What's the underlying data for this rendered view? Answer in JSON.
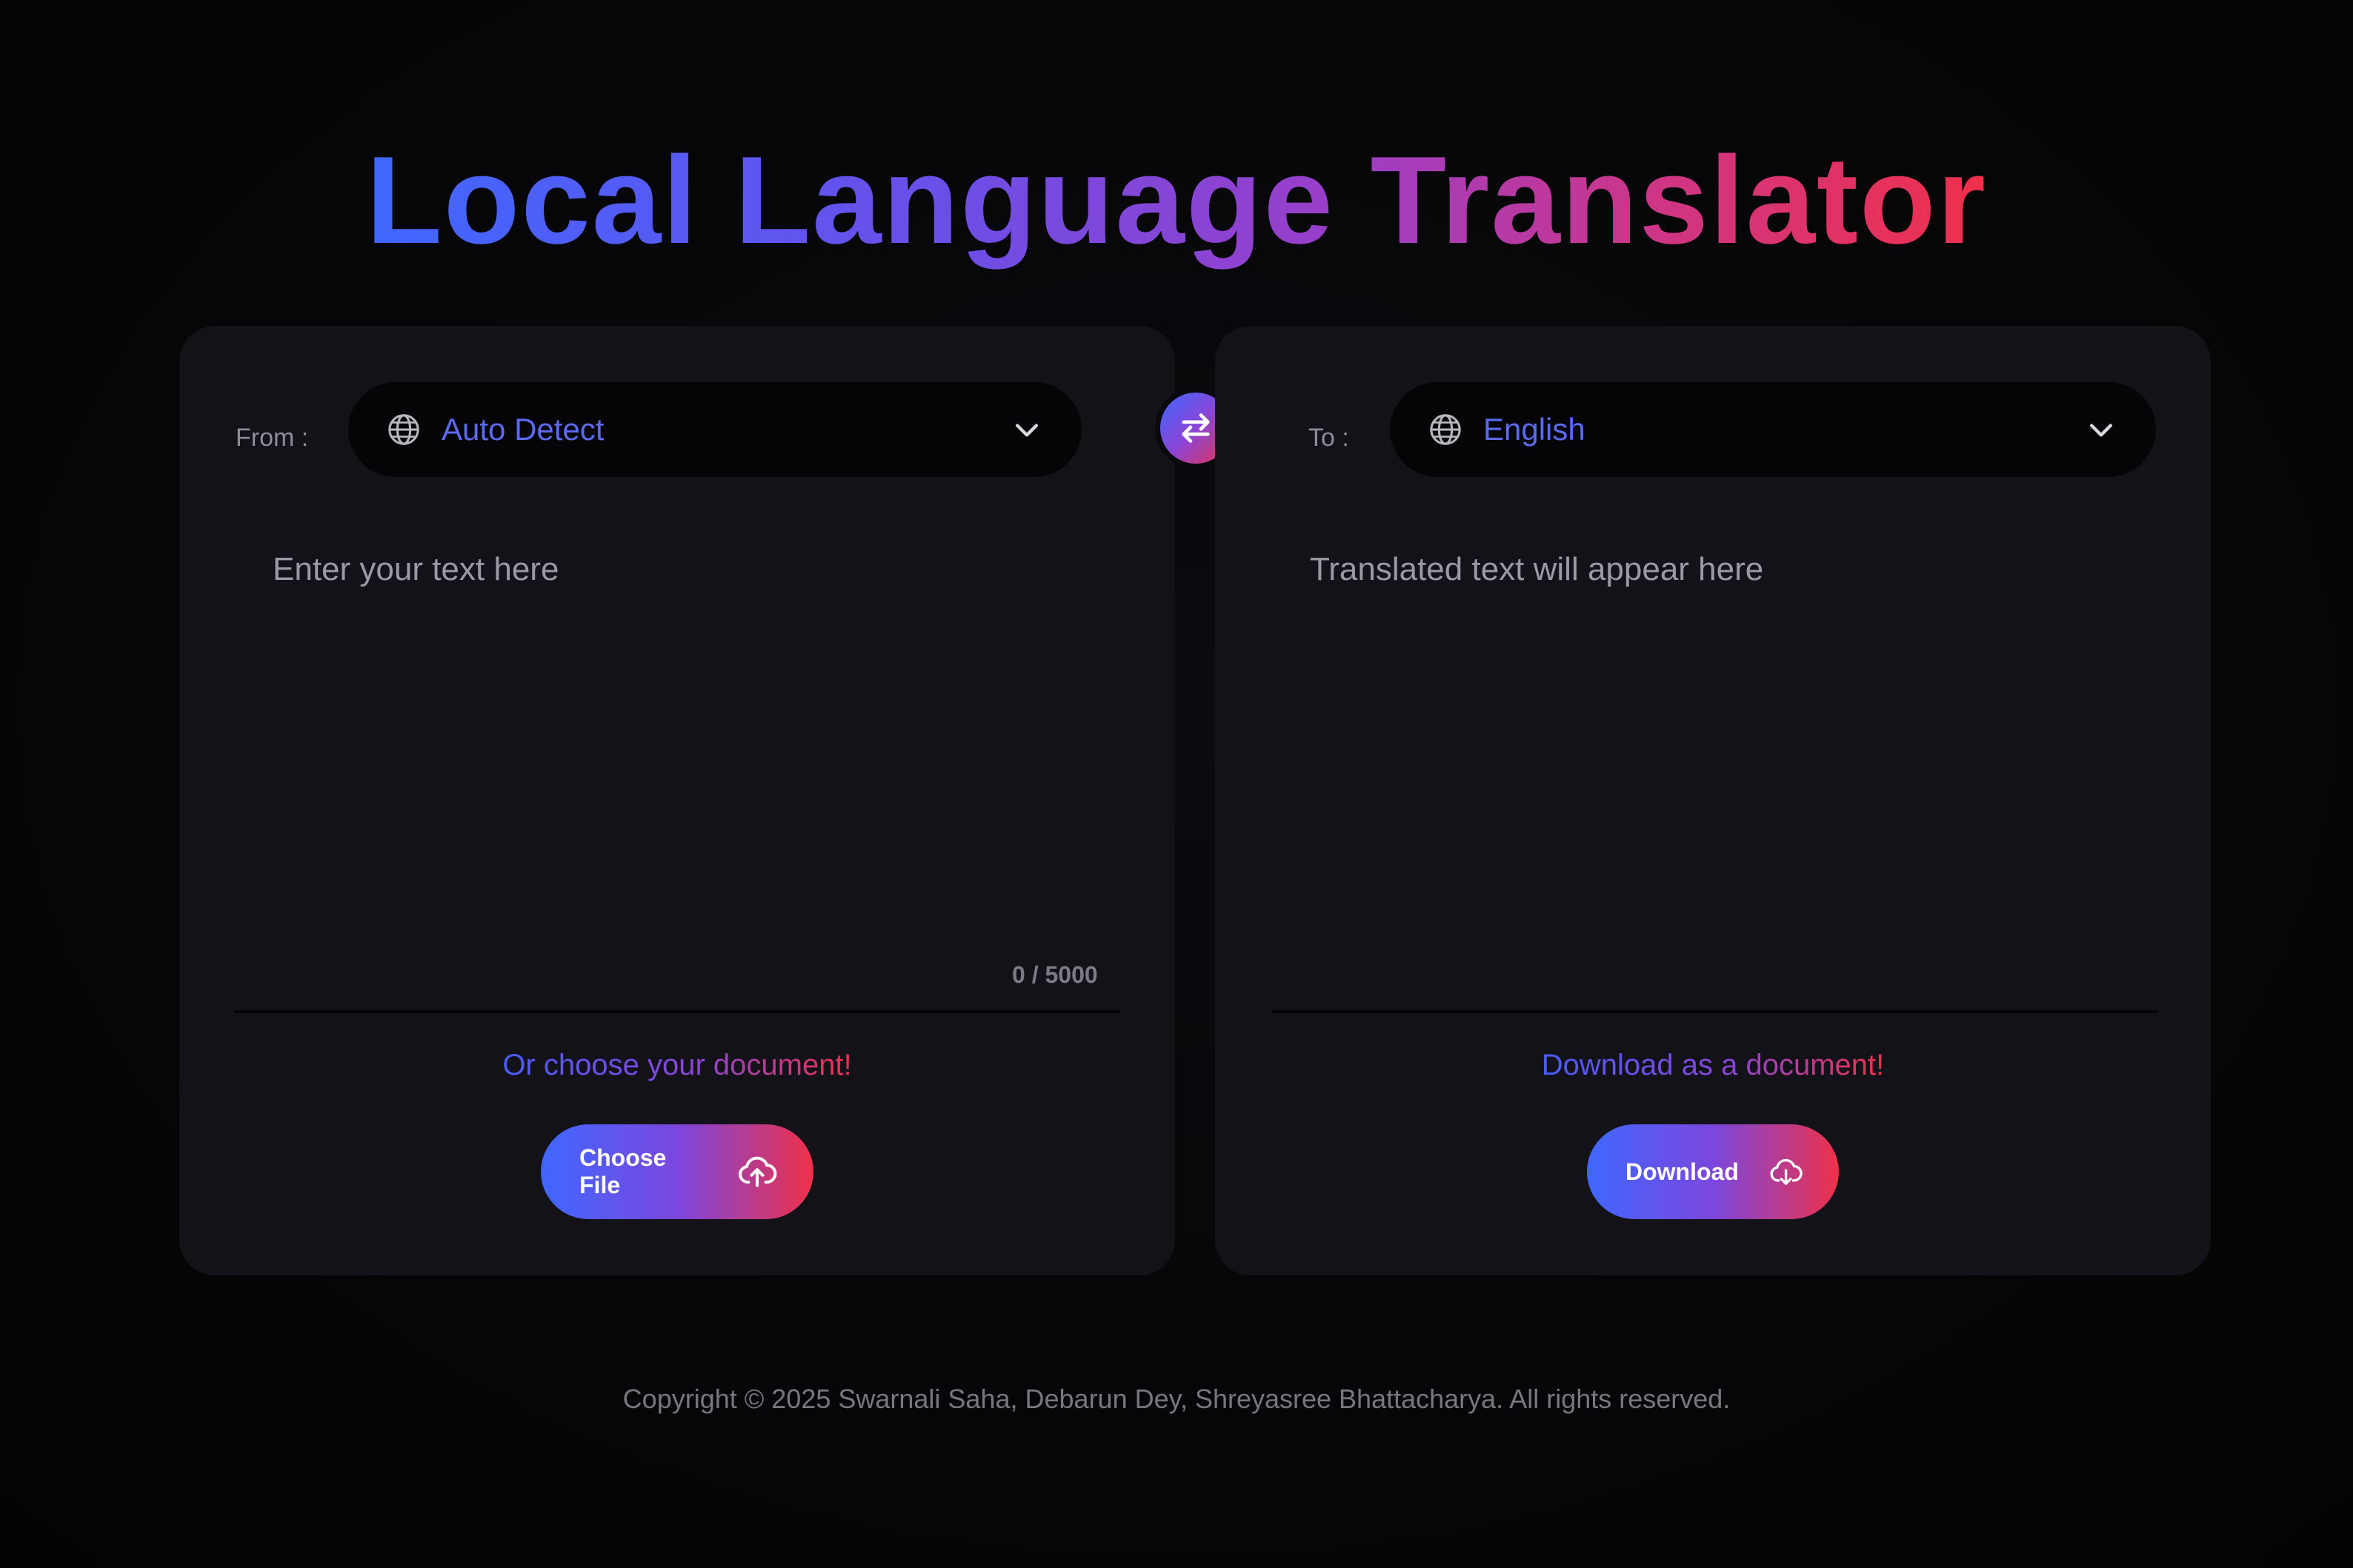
{
  "app": {
    "title": "Local Language Translator"
  },
  "source": {
    "label": "From :",
    "language": "Auto Detect",
    "placeholder": "Enter your text here",
    "char_count": "0 / 5000",
    "doc_prompt": "Or choose your document!",
    "button_label": "Choose File"
  },
  "target": {
    "label": "To :",
    "language": "English",
    "placeholder": "Translated text will appear here",
    "doc_prompt": "Download as a document!",
    "button_label": "Download"
  },
  "footer": {
    "copyright": "Copyright © 2025 Swarnali Saha, Debarun Dey, Shreyasree Bhattacharya. All rights reserved."
  },
  "icons": {
    "language_select": "globe-icon",
    "dropdown": "chevron-down-icon",
    "swap": "swap-arrows-icon",
    "upload": "cloud-upload-icon",
    "download": "cloud-download-icon"
  },
  "colors": {
    "accent_start": "#3f67ff",
    "accent_mid": "#8a45d6",
    "accent_end": "#f0304a",
    "panel_bg": "#121218",
    "page_bg": "#050507"
  }
}
